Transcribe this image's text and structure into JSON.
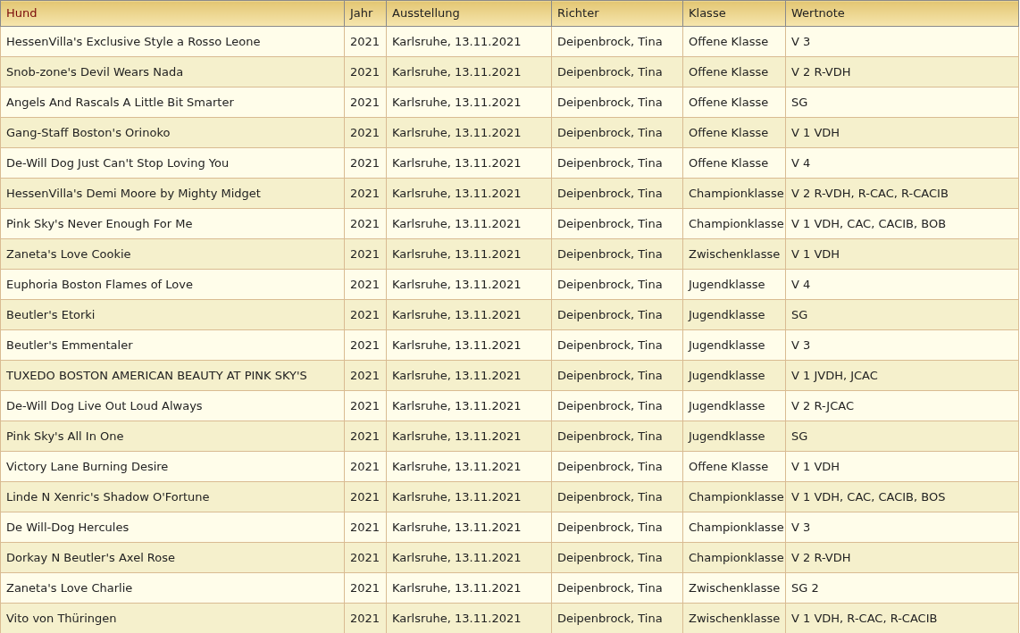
{
  "table": {
    "columns": [
      {
        "label": "Hund",
        "sorted": true
      },
      {
        "label": "Jahr",
        "sorted": false
      },
      {
        "label": "Ausstellung",
        "sorted": false
      },
      {
        "label": "Richter",
        "sorted": false
      },
      {
        "label": "Klasse",
        "sorted": false
      },
      {
        "label": "Wertnote",
        "sorted": false
      }
    ],
    "rows": [
      [
        "HessenVilla's Exclusive Style a Rosso Leone",
        "2021",
        "Karlsruhe, 13.11.2021",
        "Deipenbrock, Tina",
        "Offene Klasse",
        "V 3"
      ],
      [
        "Snob-zone's Devil Wears Nada",
        "2021",
        "Karlsruhe, 13.11.2021",
        "Deipenbrock, Tina",
        "Offene Klasse",
        "V 2 R-VDH"
      ],
      [
        "Angels And Rascals A Little Bit Smarter",
        "2021",
        "Karlsruhe, 13.11.2021",
        "Deipenbrock, Tina",
        "Offene Klasse",
        "SG"
      ],
      [
        "Gang-Staff Boston's Orinoko",
        "2021",
        "Karlsruhe, 13.11.2021",
        "Deipenbrock, Tina",
        "Offene Klasse",
        "V 1 VDH"
      ],
      [
        "De-Will Dog Just Can't Stop Loving You",
        "2021",
        "Karlsruhe, 13.11.2021",
        "Deipenbrock, Tina",
        "Offene Klasse",
        "V 4"
      ],
      [
        "HessenVilla's Demi Moore by Mighty Midget",
        "2021",
        "Karlsruhe, 13.11.2021",
        "Deipenbrock, Tina",
        "Championklasse",
        "V 2 R-VDH, R-CAC, R-CACIB"
      ],
      [
        "Pink Sky's Never Enough For Me",
        "2021",
        "Karlsruhe, 13.11.2021",
        "Deipenbrock, Tina",
        "Championklasse",
        "V 1 VDH, CAC, CACIB, BOB"
      ],
      [
        "Zaneta's Love Cookie",
        "2021",
        "Karlsruhe, 13.11.2021",
        "Deipenbrock, Tina",
        "Zwischenklasse",
        "V 1 VDH"
      ],
      [
        "Euphoria Boston Flames of Love",
        "2021",
        "Karlsruhe, 13.11.2021",
        "Deipenbrock, Tina",
        "Jugendklasse",
        "V 4"
      ],
      [
        "Beutler's Etorki",
        "2021",
        "Karlsruhe, 13.11.2021",
        "Deipenbrock, Tina",
        "Jugendklasse",
        "SG"
      ],
      [
        "Beutler's Emmentaler",
        "2021",
        "Karlsruhe, 13.11.2021",
        "Deipenbrock, Tina",
        "Jugendklasse",
        "V 3"
      ],
      [
        "TUXEDO BOSTON AMERICAN BEAUTY AT PINK SKY'S",
        "2021",
        "Karlsruhe, 13.11.2021",
        "Deipenbrock, Tina",
        "Jugendklasse",
        "V 1 JVDH, JCAC"
      ],
      [
        "De-Will Dog Live Out Loud Always",
        "2021",
        "Karlsruhe, 13.11.2021",
        "Deipenbrock, Tina",
        "Jugendklasse",
        "V 2 R-JCAC"
      ],
      [
        "Pink Sky's All In One",
        "2021",
        "Karlsruhe, 13.11.2021",
        "Deipenbrock, Tina",
        "Jugendklasse",
        "SG"
      ],
      [
        "Victory Lane Burning Desire",
        "2021",
        "Karlsruhe, 13.11.2021",
        "Deipenbrock, Tina",
        "Offene Klasse",
        "V 1 VDH"
      ],
      [
        "Linde N Xenric's Shadow O'Fortune",
        "2021",
        "Karlsruhe, 13.11.2021",
        "Deipenbrock, Tina",
        "Championklasse",
        "V 1 VDH, CAC, CACIB, BOS"
      ],
      [
        "De Will-Dog Hercules",
        "2021",
        "Karlsruhe, 13.11.2021",
        "Deipenbrock, Tina",
        "Championklasse",
        "V 3"
      ],
      [
        "Dorkay N Beutler's Axel Rose",
        "2021",
        "Karlsruhe, 13.11.2021",
        "Deipenbrock, Tina",
        "Championklasse",
        "V 2 R-VDH"
      ],
      [
        "Zaneta's Love Charlie",
        "2021",
        "Karlsruhe, 13.11.2021",
        "Deipenbrock, Tina",
        "Zwischenklasse",
        "SG 2"
      ],
      [
        "Vito von Thüringen",
        "2021",
        "Karlsruhe, 13.11.2021",
        "Deipenbrock, Tina",
        "Zwischenklasse",
        "V 1 VDH, R-CAC, R-CACIB"
      ]
    ]
  }
}
